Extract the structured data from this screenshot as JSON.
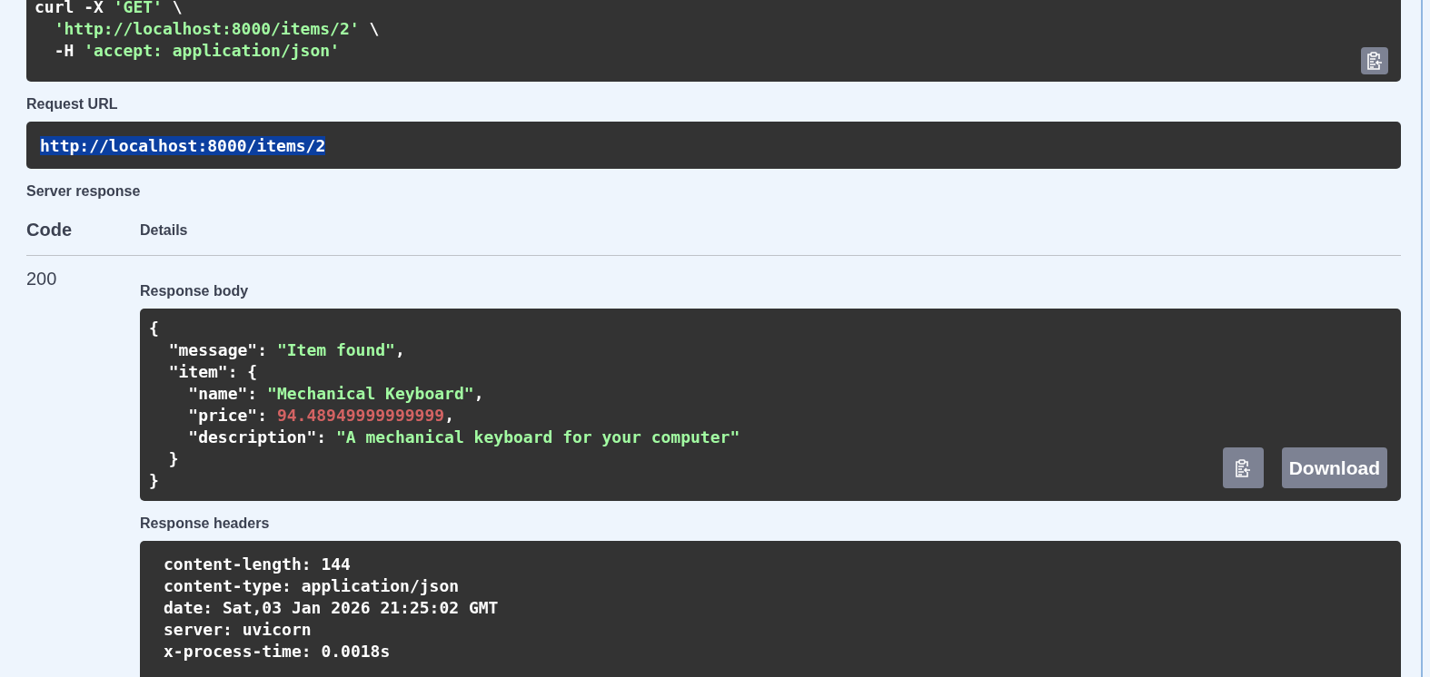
{
  "curl": {
    "lines": [
      [
        {
          "text": "curl -X ",
          "kind": "plain"
        },
        {
          "text": "'GET'",
          "kind": "string"
        },
        {
          "text": " \\",
          "kind": "plain"
        }
      ],
      [
        {
          "text": "  'http://localhost:8000/items/2'",
          "kind": "string"
        },
        {
          "text": " \\",
          "kind": "plain"
        }
      ],
      [
        {
          "text": "  -H ",
          "kind": "plain"
        },
        {
          "text": "'accept: application/json'",
          "kind": "string"
        }
      ]
    ]
  },
  "request_url": {
    "label": "Request URL",
    "url": "http://localhost:8000/items/2",
    "selected": true
  },
  "server_response": {
    "label": "Server response",
    "columns": [
      "Code",
      "Details"
    ],
    "code": "200",
    "body_label": "Response body",
    "body_lines": [
      [
        {
          "text": "{",
          "kind": "plain"
        }
      ],
      [
        {
          "text": "  \"message\": ",
          "kind": "plain"
        },
        {
          "text": "\"Item found\"",
          "kind": "string"
        },
        {
          "text": ",",
          "kind": "plain"
        }
      ],
      [
        {
          "text": "  \"item\": {",
          "kind": "plain"
        }
      ],
      [
        {
          "text": "    \"name\": ",
          "kind": "plain"
        },
        {
          "text": "\"Mechanical Keyboard\"",
          "kind": "string"
        },
        {
          "text": ",",
          "kind": "plain"
        }
      ],
      [
        {
          "text": "    \"price\": ",
          "kind": "plain"
        },
        {
          "text": "94.48949999999999",
          "kind": "number"
        },
        {
          "text": ",",
          "kind": "plain"
        }
      ],
      [
        {
          "text": "    \"description\": ",
          "kind": "plain"
        },
        {
          "text": "\"A mechanical keyboard for your computer\"",
          "kind": "string"
        }
      ],
      [
        {
          "text": "  }",
          "kind": "plain"
        }
      ],
      [
        {
          "text": "}",
          "kind": "plain"
        }
      ]
    ],
    "download": "Download",
    "headers_label": "Response headers",
    "headers": [
      "content-length: 144",
      "content-type: application/json",
      "date: Sat,03 Jan 2026 21:25:02 GMT",
      "server: uvicorn",
      "x-process-time: 0.0018s"
    ]
  }
}
